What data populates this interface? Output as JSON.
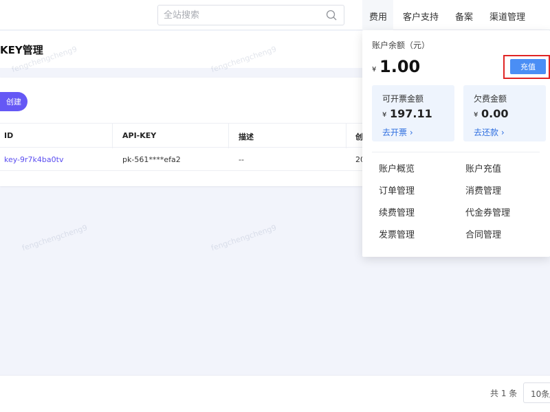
{
  "header": {
    "search_placeholder": "全站搜索",
    "nav": [
      "费用",
      "客户支持",
      "备案",
      "渠道管理"
    ]
  },
  "page": {
    "title": "KEY管理",
    "create_label": "创建",
    "columns": [
      "ID",
      "API-KEY",
      "描述",
      "创"
    ],
    "rows": [
      {
        "id": "key-9r7k4ba0tv",
        "api_key": "pk-561****efa2",
        "desc": "--",
        "created": "20"
      }
    ]
  },
  "pagination": {
    "total": "共 1 条",
    "page_size": "10条/"
  },
  "watermark": "fengchengcheng9",
  "dropdown": {
    "balance_label": "账户余额（元）",
    "currency": "¥",
    "balance": "1.00",
    "recharge_label": "充值",
    "cards": [
      {
        "label": "可开票金额",
        "value": "197.11",
        "link": "去开票"
      },
      {
        "label": "欠费金额",
        "value": "0.00",
        "link": "去还款"
      }
    ],
    "menu": [
      "账户概览",
      "账户充值",
      "订单管理",
      "消费管理",
      "续费管理",
      "代金券管理",
      "发票管理",
      "合同管理"
    ]
  },
  "colors": {
    "primary": "#6558f5",
    "link": "#2f6fe0",
    "recharge": "#4a8ef5",
    "highlight": "#e02424"
  }
}
